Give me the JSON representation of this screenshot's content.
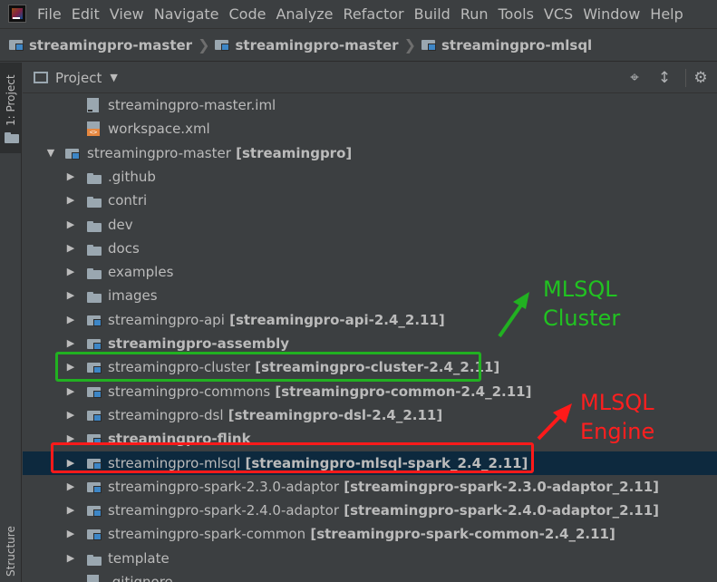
{
  "menu": [
    "File",
    "Edit",
    "View",
    "Navigate",
    "Code",
    "Analyze",
    "Refactor",
    "Build",
    "Run",
    "Tools",
    "VCS",
    "Window",
    "Help"
  ],
  "breadcrumbs": [
    "streamingpro-master",
    "streamingpro-master",
    "streamingpro-mlsql"
  ],
  "left_strip": {
    "project_tab": "1: Project",
    "structure_tab": "Structure"
  },
  "panel": {
    "title": "Project"
  },
  "tree": [
    {
      "name": "streamingpro-master.iml",
      "module": "",
      "icon": "iml-file-icon",
      "depth": 2,
      "arrow": ""
    },
    {
      "name": "workspace.xml",
      "module": "",
      "icon": "xml-file-icon",
      "depth": 2,
      "arrow": ""
    },
    {
      "name": "streamingpro-master",
      "module": "[streamingpro]",
      "icon": "module-folder-icon",
      "depth": 1,
      "arrow": "expanded"
    },
    {
      "name": ".github",
      "module": "",
      "icon": "folder-icon",
      "depth": 2,
      "arrow": "collapsed"
    },
    {
      "name": "contri",
      "module": "",
      "icon": "folder-icon",
      "depth": 2,
      "arrow": "collapsed"
    },
    {
      "name": "dev",
      "module": "",
      "icon": "folder-icon",
      "depth": 2,
      "arrow": "collapsed"
    },
    {
      "name": "docs",
      "module": "",
      "icon": "folder-icon",
      "depth": 2,
      "arrow": "collapsed"
    },
    {
      "name": "examples",
      "module": "",
      "icon": "folder-icon",
      "depth": 2,
      "arrow": "collapsed"
    },
    {
      "name": "images",
      "module": "",
      "icon": "folder-icon",
      "depth": 2,
      "arrow": "collapsed"
    },
    {
      "name": "streamingpro-api",
      "module": "[streamingpro-api-2.4_2.11]",
      "icon": "module-folder-icon",
      "depth": 2,
      "arrow": "collapsed"
    },
    {
      "name": "streamingpro-assembly",
      "module": "",
      "icon": "module-folder-icon",
      "depth": 2,
      "arrow": "collapsed",
      "bold": true
    },
    {
      "name": "streamingpro-cluster",
      "module": "[streamingpro-cluster-2.4_2.11]",
      "icon": "module-folder-icon",
      "depth": 2,
      "arrow": "collapsed"
    },
    {
      "name": "streamingpro-commons",
      "module": "[streamingpro-common-2.4_2.11]",
      "icon": "module-folder-icon",
      "depth": 2,
      "arrow": "collapsed"
    },
    {
      "name": "streamingpro-dsl",
      "module": "[streamingpro-dsl-2.4_2.11]",
      "icon": "module-folder-icon",
      "depth": 2,
      "arrow": "collapsed"
    },
    {
      "name": "streamingpro-flink",
      "module": "",
      "icon": "module-folder-icon",
      "depth": 2,
      "arrow": "collapsed",
      "bold": true
    },
    {
      "name": "streamingpro-mlsql",
      "module": "[streamingpro-mlsql-spark_2.4_2.11]",
      "icon": "module-folder-icon",
      "depth": 2,
      "arrow": "collapsed",
      "selected": true
    },
    {
      "name": "streamingpro-spark-2.3.0-adaptor",
      "module": "[streamingpro-spark-2.3.0-adaptor_2.11]",
      "icon": "module-folder-icon",
      "depth": 2,
      "arrow": "collapsed"
    },
    {
      "name": "streamingpro-spark-2.4.0-adaptor",
      "module": "[streamingpro-spark-2.4.0-adaptor_2.11]",
      "icon": "module-folder-icon",
      "depth": 2,
      "arrow": "collapsed"
    },
    {
      "name": "streamingpro-spark-common",
      "module": "[streamingpro-spark-common-2.4_2.11]",
      "icon": "module-folder-icon",
      "depth": 2,
      "arrow": "collapsed"
    },
    {
      "name": "template",
      "module": "",
      "icon": "folder-icon",
      "depth": 2,
      "arrow": "collapsed"
    },
    {
      "name": ".gitignore",
      "module": "",
      "icon": "gitignore-file-icon",
      "depth": 2,
      "arrow": ""
    }
  ],
  "annotations": {
    "cluster": {
      "line1": "MLSQL",
      "line2": "Cluster",
      "color": "#21c321"
    },
    "engine": {
      "line1": "MLSQL",
      "line2": "Engine",
      "color": "#ff1f1f"
    }
  },
  "colors": {
    "background": "#3c3f41",
    "selection": "#0d293e",
    "text": "#bbbbbb"
  }
}
